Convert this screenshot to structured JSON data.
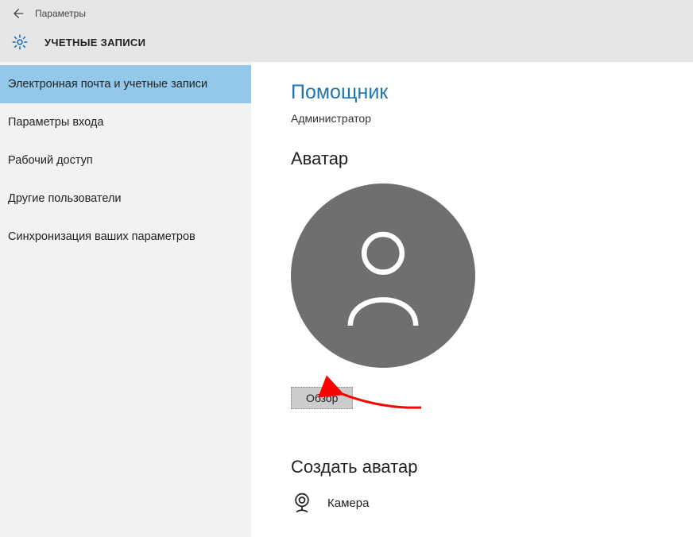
{
  "window": {
    "title": "Параметры"
  },
  "header": {
    "title": "УЧЕТНЫЕ ЗАПИСИ"
  },
  "sidebar": {
    "items": [
      {
        "label": "Электронная почта и учетные записи",
        "selected": true
      },
      {
        "label": "Параметры входа",
        "selected": false
      },
      {
        "label": "Рабочий доступ",
        "selected": false
      },
      {
        "label": "Другие пользователи",
        "selected": false
      },
      {
        "label": "Синхронизация ваших параметров",
        "selected": false
      }
    ]
  },
  "main": {
    "username": "Помощник",
    "role": "Администратор",
    "avatar_heading": "Аватар",
    "browse_label": "Обзор",
    "create_heading": "Создать аватар",
    "camera_label": "Камера"
  },
  "colors": {
    "accent": "#1f74b4",
    "sidebar_selected": "#93c8ea",
    "chrome_bg": "#e6e6e6",
    "sidebar_bg": "#f2f2f2",
    "avatar_bg": "#6f6f6f"
  }
}
